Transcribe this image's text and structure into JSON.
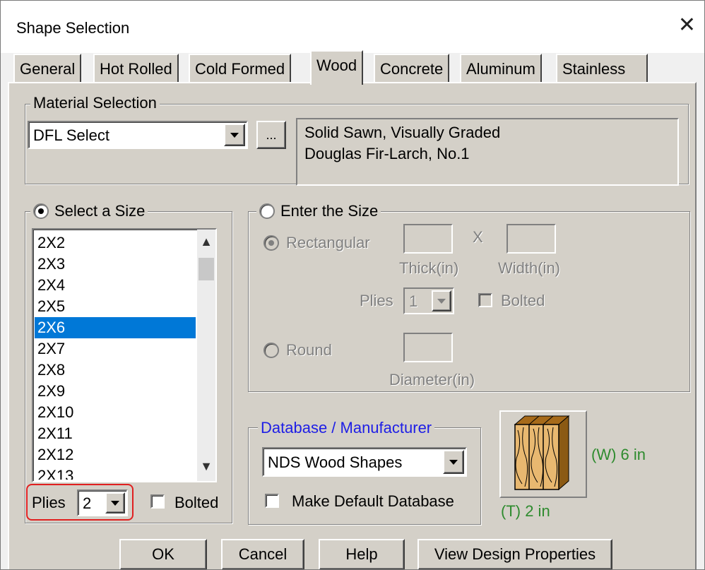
{
  "window": {
    "title": "Shape Selection"
  },
  "tabs": [
    {
      "label": "General",
      "active": false
    },
    {
      "label": "Hot Rolled",
      "active": false
    },
    {
      "label": "Cold Formed",
      "active": false
    },
    {
      "label": "Wood",
      "active": true
    },
    {
      "label": "Concrete",
      "active": false
    },
    {
      "label": "Aluminum",
      "active": false
    },
    {
      "label": "Stainless",
      "active": false
    }
  ],
  "material": {
    "group_label": "Material Selection",
    "selected": "DFL Select",
    "browse_label": "...",
    "description_line1": "Solid Sawn, Visually Graded",
    "description_line2": "Douglas Fir-Larch, No.1"
  },
  "select_size": {
    "label": "Select a Size",
    "checked": true,
    "items": [
      "2X2",
      "2X3",
      "2X4",
      "2X5",
      "2X6",
      "2X7",
      "2X8",
      "2X9",
      "2X10",
      "2X11",
      "2X12",
      "2X13"
    ],
    "selected_item": "2X6",
    "plies_label": "Plies",
    "plies_value": "2",
    "bolted_label": "Bolted",
    "bolted_checked": false
  },
  "enter_size": {
    "label": "Enter the Size",
    "checked": false,
    "rectangular_label": "Rectangular",
    "x_label": "X",
    "thick_label": "Thick(in)",
    "width_label": "Width(in)",
    "plies_label": "Plies",
    "plies_value": "1",
    "bolted_label": "Bolted",
    "round_label": "Round",
    "diameter_label": "Diameter(in)"
  },
  "database": {
    "group_label": "Database / Manufacturer",
    "selected": "NDS Wood Shapes",
    "make_default_label": "Make Default Database",
    "make_default_checked": false
  },
  "preview": {
    "width_label": "(W) 6 in",
    "thickness_label": "(T) 2 in"
  },
  "buttons": {
    "ok": "OK",
    "cancel": "Cancel",
    "help": "Help",
    "view_props": "View Design Properties"
  },
  "colors": {
    "dialog_gray": "#d4d0c8",
    "selection_blue": "#0078d7",
    "highlight_red": "#e02020",
    "legend_blue": "#1e1ee6",
    "dimension_green": "#2e8b2e",
    "wood": "#e8b870"
  }
}
